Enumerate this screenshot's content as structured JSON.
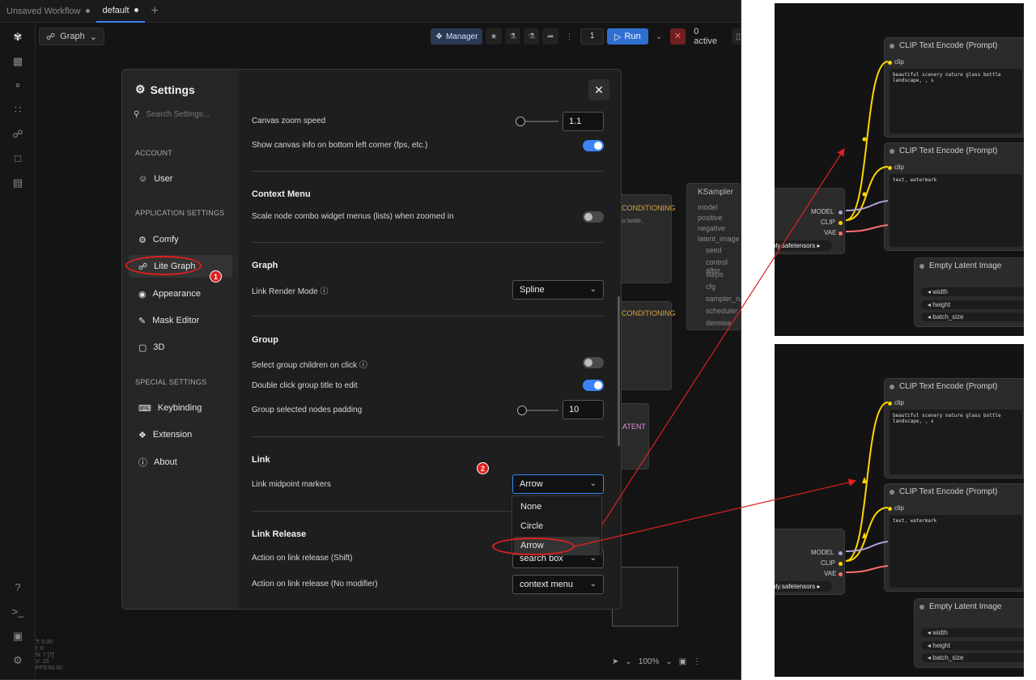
{
  "tabs": [
    {
      "label": "Unsaved Workflow",
      "active": false
    },
    {
      "label": "default",
      "active": true
    }
  ],
  "toolbar": {
    "graph_label": "Graph",
    "manager_label": "Manager",
    "queue_count": "1",
    "run_label": "Run",
    "active_label": "0 active"
  },
  "settings": {
    "title": "Settings",
    "search_placeholder": "Search Settings...",
    "sidebar": {
      "account_header": "ACCOUNT",
      "user": "User",
      "app_header": "APPLICATION SETTINGS",
      "comfy": "Comfy",
      "lite_graph": "Lite Graph",
      "appearance": "Appearance",
      "mask_editor": "Mask Editor",
      "three_d": "3D",
      "special_header": "SPECIAL SETTINGS",
      "keybinding": "Keybinding",
      "extension": "Extension",
      "about": "About"
    },
    "canvas_zoom_speed_label": "Canvas zoom speed",
    "canvas_zoom_speed_value": "1.1",
    "canvas_zoom_speed_level": 0.05,
    "show_canvas_info_label": "Show canvas info on bottom left corner (fps, etc.)",
    "show_canvas_info_on": true,
    "context_menu_header": "Context Menu",
    "scale_combo_label": "Scale node combo widget menus (lists) when zoomed in",
    "scale_combo_on": false,
    "graph_header": "Graph",
    "link_render_mode_label": "Link Render Mode",
    "link_render_mode_value": "Spline",
    "group_header": "Group",
    "select_group_children_label": "Select group children on click",
    "select_group_children_on": false,
    "double_click_group_label": "Double click group title to edit",
    "double_click_group_on": true,
    "group_padding_label": "Group selected nodes padding",
    "group_padding_value": "10",
    "group_padding_level": 0.1,
    "link_header": "Link",
    "link_midpoint_label": "Link midpoint markers",
    "link_midpoint_value": "Arrow",
    "link_midpoint_options": [
      "None",
      "Circle",
      "Arrow"
    ],
    "link_release_header": "Link Release",
    "action_shift_label": "Action on link release (Shift)",
    "action_shift_value": "search box",
    "action_nomod_label": "Action on link release (No modifier)",
    "action_nomod_value": "context menu"
  },
  "annotations": {
    "badge1": "1",
    "badge2": "2"
  },
  "canvas": {
    "zoom": "100%",
    "ksampler_title": "KSampler",
    "conditioning": "CONDITIONING",
    "latent": "LATENT",
    "ksampler_ports": [
      "model",
      "positive",
      "negative",
      "latent_image"
    ],
    "ksampler_widgets": [
      "seed",
      "control after",
      "steps",
      "cfg",
      "sampler_na",
      "scheduler",
      "denoise"
    ],
    "snippet": "ss bottle,"
  },
  "panels": {
    "clip_title": "CLIP Text Encode (Prompt)",
    "clip_port": "clip",
    "prompt_positive": "beautiful scenery nature glass bottle landscape, , s",
    "prompt_negative": "text, watermark",
    "outputs": [
      "MODEL",
      "CLIP",
      "VAE"
    ],
    "ckpt_name": "nly.safetensors",
    "latent_title": "Empty Latent Image",
    "latent_widgets": [
      "width",
      "height",
      "batch_size"
    ]
  },
  "colors": {
    "accent": "#3b82f6",
    "annotation_red": "#e02020",
    "clip_link": "#ffd500",
    "model_link": "#b39ddb",
    "vae_link": "#ff6e6e"
  }
}
